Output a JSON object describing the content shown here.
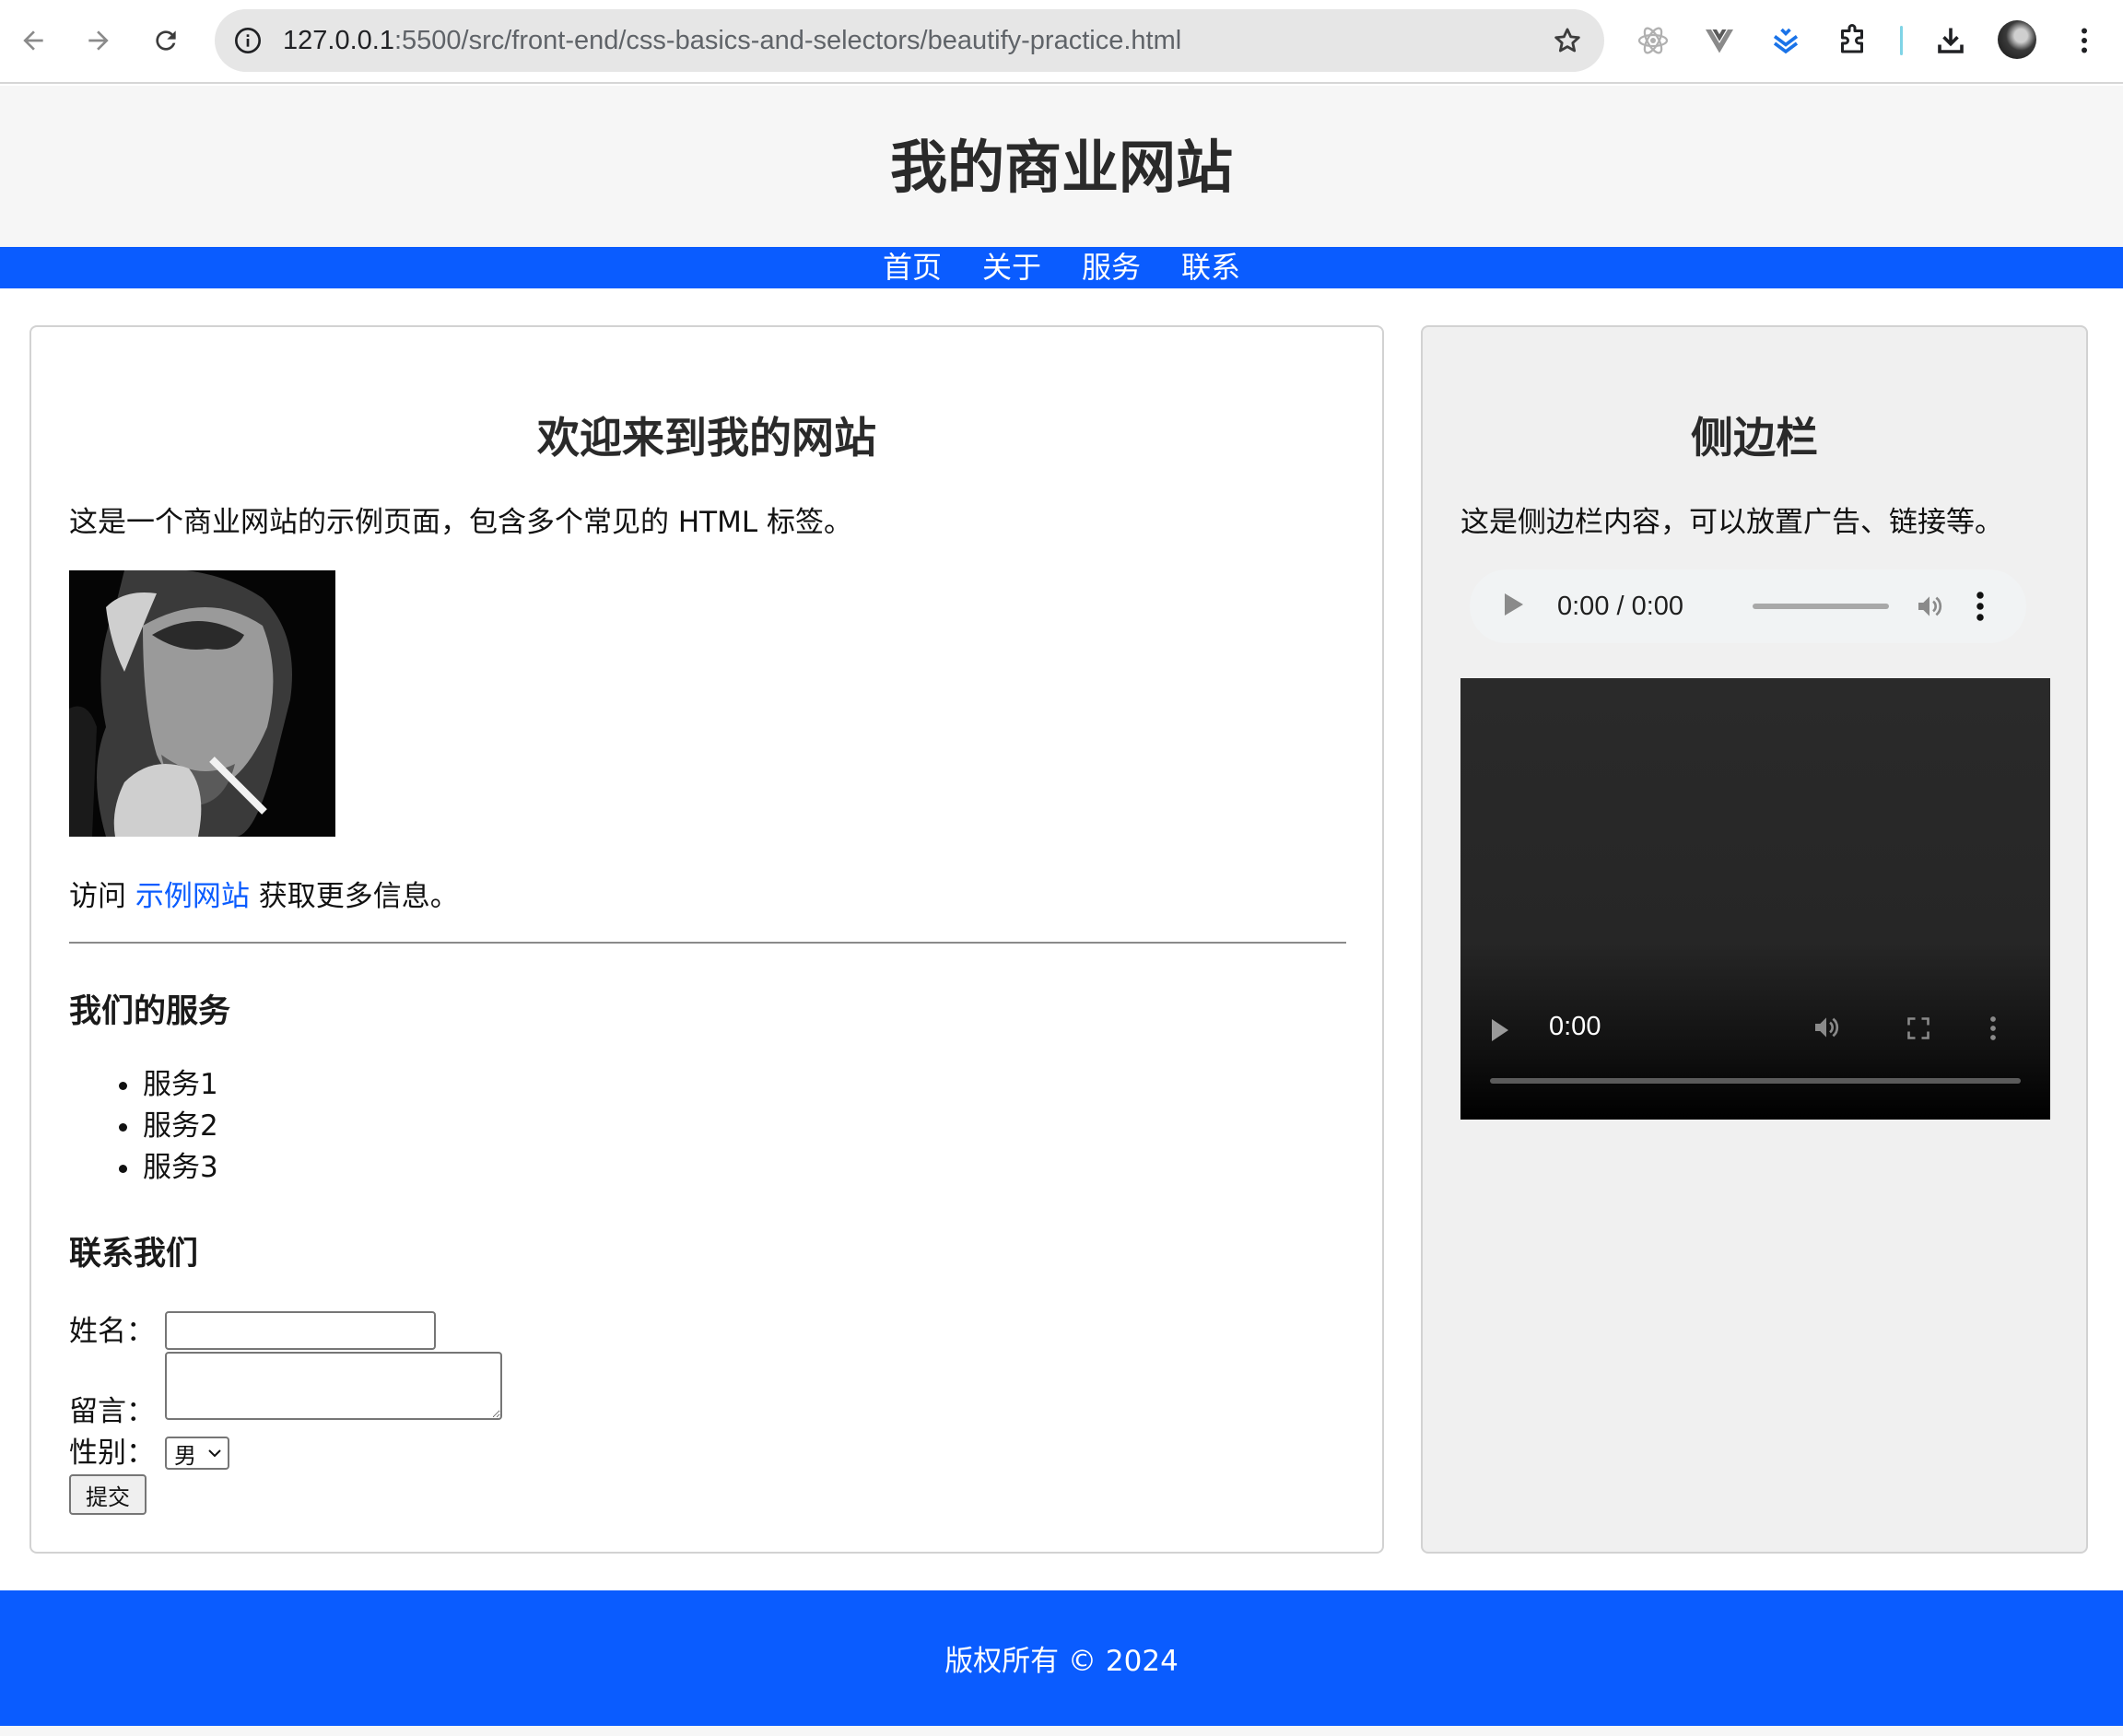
{
  "browser": {
    "url_host": "127.0.0.1",
    "url_path": ":5500/src/front-end/css-basics-and-selectors/beautify-practice.html",
    "icons": [
      "back-icon",
      "forward-icon",
      "reload-icon",
      "site-info-icon",
      "bookmark-star-icon",
      "react-devtools-icon",
      "vue-devtools-icon",
      "extension-stack-icon",
      "extensions-puzzle-icon",
      "download-icon",
      "profile-avatar",
      "more-menu-icon"
    ]
  },
  "header": {
    "title": "我的商业网站"
  },
  "nav": {
    "items": [
      "首页",
      "关于",
      "服务",
      "联系"
    ]
  },
  "main": {
    "title": "欢迎来到我的网站",
    "intro": "这是一个商业网站的示例页面，包含多个常见的 HTML 标签。",
    "visit_prefix": "访问",
    "visit_link": "示例网站",
    "visit_suffix": "获取更多信息。",
    "services_heading": "我们的服务",
    "services": [
      "服务1",
      "服务2",
      "服务3"
    ],
    "contact_heading": "联系我们",
    "form": {
      "name_label": "姓名：",
      "name_value": "",
      "message_label": "留言：",
      "message_value": "",
      "gender_label": "性别：",
      "gender_selected": "男",
      "submit_label": "提交"
    }
  },
  "sidebar": {
    "title": "侧边栏",
    "text": "这是侧边栏内容，可以放置广告、链接等。",
    "audio_time": "0:00 / 0:00",
    "video_time": "0:00"
  },
  "footer": {
    "text": "版权所有 © 2024"
  },
  "colors": {
    "brand_blue": "#0a5cff",
    "header_bg": "#f6f6f6",
    "sidebar_bg": "#f0f0f0"
  }
}
